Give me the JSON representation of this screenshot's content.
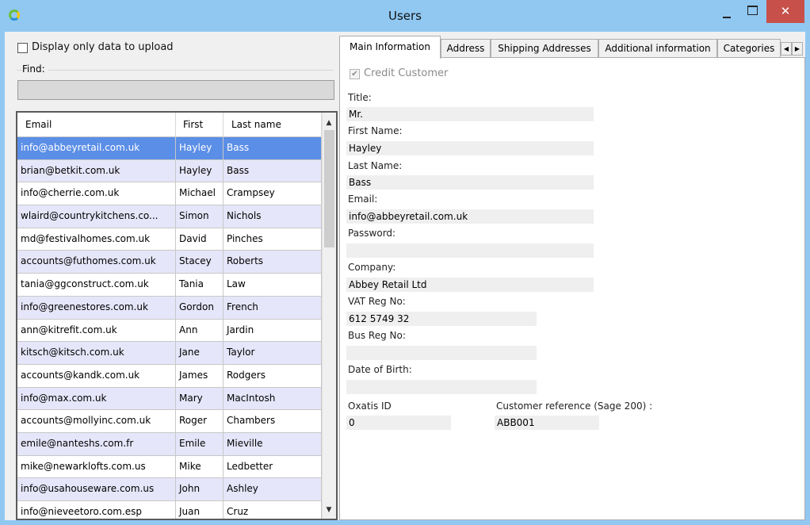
{
  "window": {
    "title": "Users",
    "close_glyph": "✕",
    "icons": {
      "app": "app-icon",
      "minimize": "minimize-icon",
      "maximize": "maximize-icon",
      "close": "close-icon"
    }
  },
  "filter": {
    "display_only_label": "Display only data to upload",
    "display_only_checked": false,
    "find_label": "Find:",
    "find_value": ""
  },
  "grid": {
    "headers": {
      "email": "Email",
      "first": "First",
      "last": "Last name"
    },
    "scroll_up_glyph": "▲",
    "scroll_down_glyph": "▼",
    "rows": [
      {
        "email": "info@abbeyretail.com.uk",
        "first": "Hayley",
        "last": "Bass"
      },
      {
        "email": "brian@betkit.com.uk",
        "first": "Hayley",
        "last": "Bass"
      },
      {
        "email": "info@cherrie.com.uk",
        "first": "Michael",
        "last": "Crampsey"
      },
      {
        "email": "wlaird@countrykitchens.co...",
        "first": "Simon",
        "last": "Nichols"
      },
      {
        "email": "md@festivalhomes.com.uk",
        "first": "David",
        "last": "Pinches"
      },
      {
        "email": "accounts@futhomes.com.uk",
        "first": "Stacey",
        "last": "Roberts"
      },
      {
        "email": "tania@ggconstruct.com.uk",
        "first": "Tania",
        "last": "Law"
      },
      {
        "email": "info@greenestores.com.uk",
        "first": "Gordon",
        "last": "French"
      },
      {
        "email": "ann@kitrefit.com.uk",
        "first": "Ann",
        "last": "Jardin"
      },
      {
        "email": "kitsch@kitsch.com.uk",
        "first": "Jane",
        "last": "Taylor"
      },
      {
        "email": "accounts@kandk.com.uk",
        "first": "James",
        "last": "Rodgers"
      },
      {
        "email": "info@max.com.uk",
        "first": "Mary",
        "last": "MacIntosh"
      },
      {
        "email": "accounts@mollyinc.com.uk",
        "first": "Roger",
        "last": "Chambers"
      },
      {
        "email": "emile@nanteshs.com.fr",
        "first": "Emile",
        "last": "Mieville"
      },
      {
        "email": "mike@newarklofts.com.us",
        "first": "Mike",
        "last": "Ledbetter"
      },
      {
        "email": "info@usahouseware.com.us",
        "first": "John",
        "last": "Ashley"
      },
      {
        "email": "info@nieveetoro.com.esp",
        "first": "Juan",
        "last": "Cruz"
      }
    ],
    "selected_index": 0
  },
  "tabs": {
    "items": [
      "Main Information",
      "Address",
      "Shipping Addresses",
      "Additional information",
      "Categories"
    ],
    "active": "Main Information",
    "scroll_left_glyph": "◀",
    "scroll_right_glyph": "▶"
  },
  "main_info": {
    "credit_customer_label": "Credit Customer",
    "credit_customer_checked": true,
    "check_glyph": "✔",
    "title_label": "Title:",
    "title_value": "Mr.",
    "first_name_label": "First Name:",
    "first_name_value": "Hayley",
    "last_name_label": "Last Name:",
    "last_name_value": "Bass",
    "email_label": "Email:",
    "email_value": "info@abbeyretail.com.uk",
    "password_label": "Password:",
    "password_value": "",
    "company_label": "Company:",
    "company_value": "Abbey Retail Ltd",
    "vat_label": "VAT Reg No:",
    "vat_value": "612 5749 32",
    "bus_label": "Bus Reg No:",
    "bus_value": "",
    "dob_label": "Date of Birth:",
    "dob_value": "",
    "oxatis_label": "Oxatis ID",
    "oxatis_value": "0",
    "custref_label": "Customer reference (Sage 200) :",
    "custref_value": "ABB001"
  },
  "colors": {
    "titlebar": "#90c8f2",
    "close": "#c7504b",
    "selected_row": "#5b8ee6",
    "alt_row": "#e6e6fa"
  }
}
